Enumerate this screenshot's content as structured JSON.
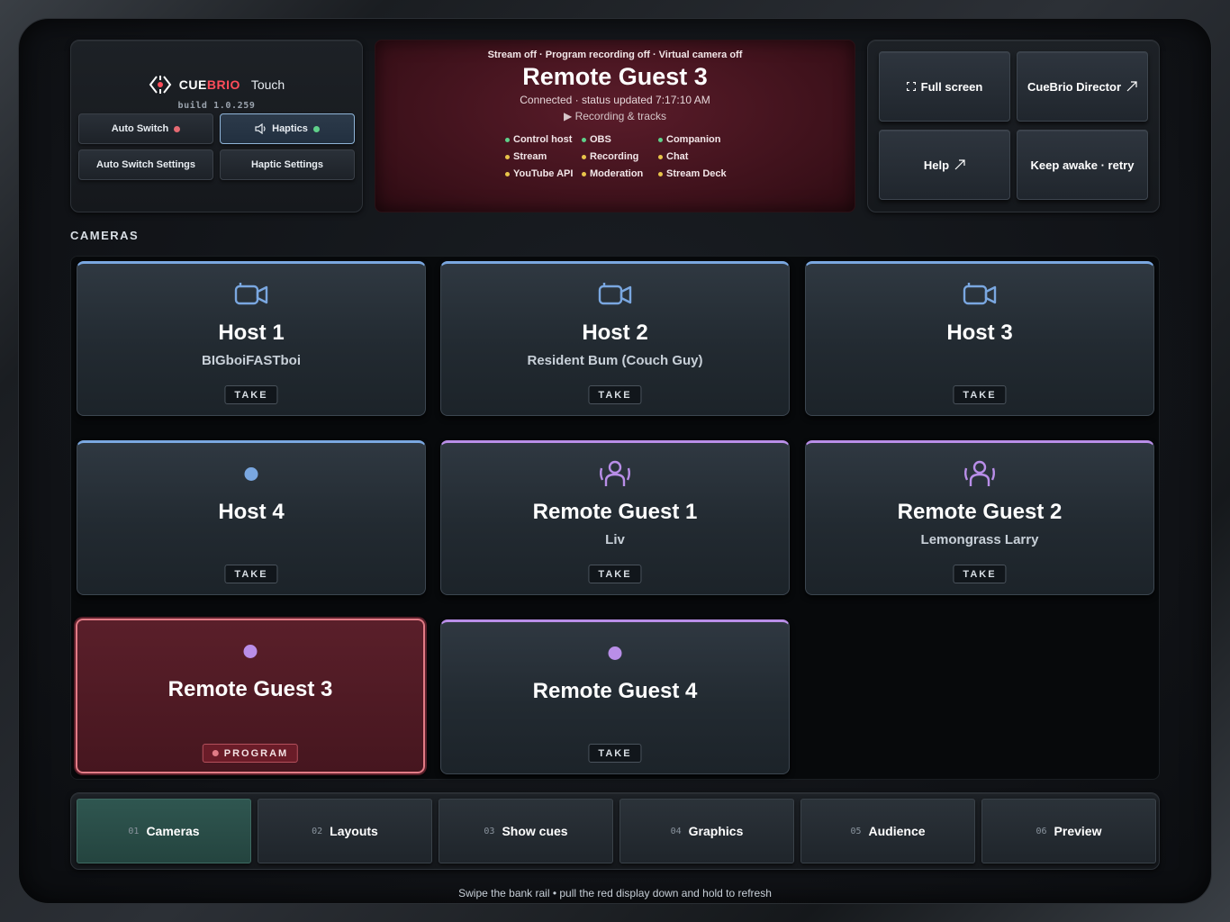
{
  "brand": {
    "name_a": "CUE",
    "name_b": "BRIO",
    "suffix": "Touch",
    "build": "build 1.0.259",
    "accent": "#ff4d5a"
  },
  "settings": {
    "auto_switch": "Auto Switch",
    "auto_switch_dot": "#e56a72",
    "haptics": "Haptics",
    "haptics_dot": "#5fd08a",
    "haptics_icon": "speaker-icon",
    "auto_switch_settings": "Auto Switch Settings",
    "haptic_settings": "Haptic Settings"
  },
  "status": {
    "top_line": "Stream off · Program recording off · Virtual camera off",
    "program_source": "Remote Guest 3",
    "connection": "Connected · status updated 7:17:10 AM",
    "recording_toggle": "▶ Recording & tracks",
    "items": [
      {
        "label": "Control host",
        "color": "#5fd08a"
      },
      {
        "label": "OBS",
        "color": "#5fd08a"
      },
      {
        "label": "Companion",
        "color": "#5fd08a"
      },
      {
        "label": "Stream",
        "color": "#e8c44a"
      },
      {
        "label": "Recording",
        "color": "#e8c44a"
      },
      {
        "label": "Chat",
        "color": "#e8c44a"
      },
      {
        "label": "YouTube API",
        "color": "#e8c44a"
      },
      {
        "label": "Moderation",
        "color": "#e8c44a"
      },
      {
        "label": "Stream Deck",
        "color": "#e8c44a"
      }
    ]
  },
  "top_actions": {
    "fullscreen": "Full screen",
    "director": "CueBrio Director",
    "help": "Help",
    "keep_awake": "Keep awake · retry"
  },
  "cameras": {
    "section_label": "CAMERAS",
    "take_label": "TAKE",
    "program_label": "PROGRAM",
    "items": [
      {
        "name": "Host 1",
        "sub": "BIGboiFASTboi",
        "icon": "video-camera-icon",
        "accent": "#7aa7e0"
      },
      {
        "name": "Host 2",
        "sub": "Resident Bum (Couch Guy)",
        "icon": "video-camera-icon",
        "accent": "#7aa7e0"
      },
      {
        "name": "Host 3",
        "sub": "",
        "icon": "video-camera-icon",
        "accent": "#7aa7e0"
      },
      {
        "name": "Host 4",
        "sub": "",
        "icon": "dot-icon",
        "accent": "#7aa7e0"
      },
      {
        "name": "Remote Guest 1",
        "sub": "Liv",
        "icon": "remote-guest-icon",
        "accent": "#b98ee8"
      },
      {
        "name": "Remote Guest 2",
        "sub": "Lemongrass Larry",
        "icon": "remote-guest-icon",
        "accent": "#b98ee8"
      },
      {
        "name": "Remote Guest 3",
        "sub": "",
        "icon": "dot-icon",
        "accent": "#b98ee8",
        "live": true
      },
      {
        "name": "Remote Guest 4",
        "sub": "",
        "icon": "dot-icon",
        "accent": "#b98ee8"
      }
    ]
  },
  "nav": {
    "items": [
      {
        "num": "01",
        "label": "Cameras",
        "active": true
      },
      {
        "num": "02",
        "label": "Layouts"
      },
      {
        "num": "03",
        "label": "Show cues"
      },
      {
        "num": "04",
        "label": "Graphics"
      },
      {
        "num": "05",
        "label": "Audience"
      },
      {
        "num": "06",
        "label": "Preview"
      }
    ]
  },
  "hint": "Swipe the bank rail • pull the red display down and hold to refresh"
}
